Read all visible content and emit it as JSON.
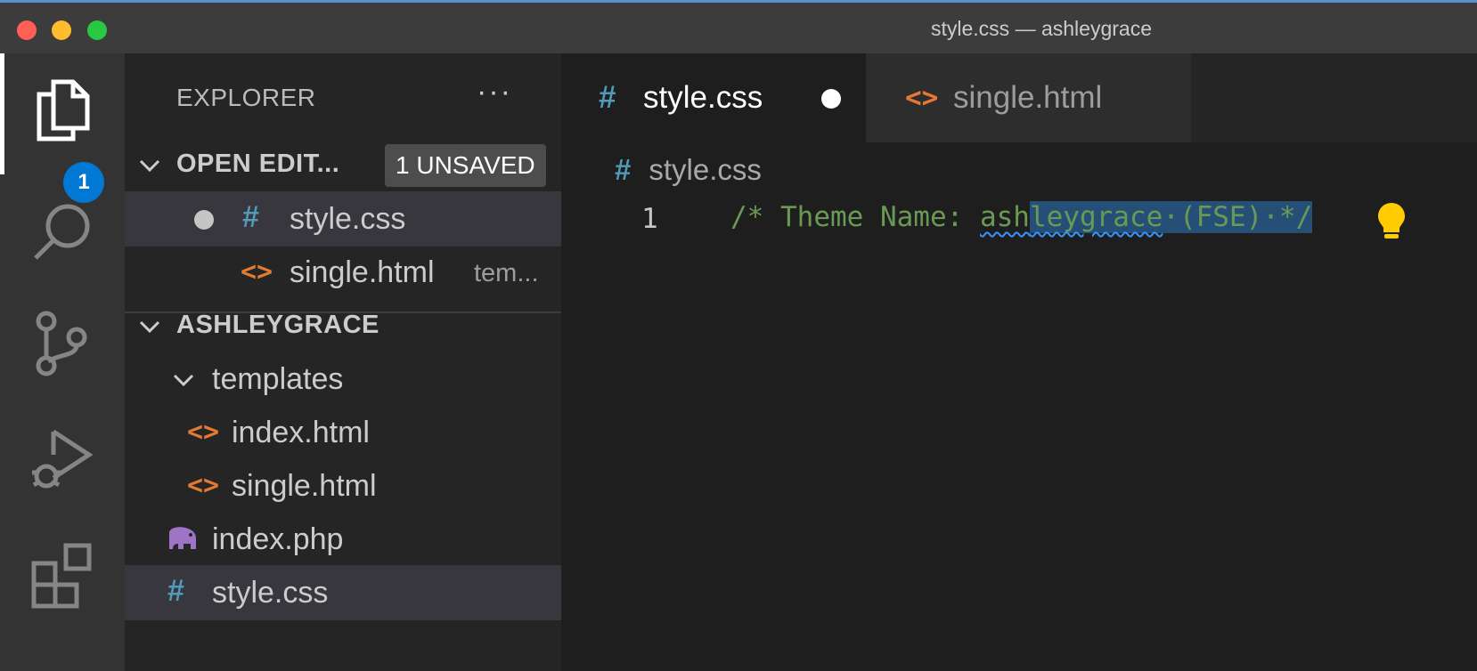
{
  "window": {
    "title": "style.css — ashleygrace"
  },
  "activity_bar": {
    "explorer_badge": "1"
  },
  "sidebar": {
    "header_title": "EXPLORER",
    "more_actions": "···",
    "open_editors": {
      "label": "OPEN EDIT...",
      "unsaved_badge": "1 UNSAVED",
      "items": [
        {
          "name": "style.css",
          "icon": "#",
          "description": "",
          "unsaved": true
        },
        {
          "name": "single.html",
          "icon": "<>",
          "description": "tem..."
        }
      ]
    },
    "workspace": {
      "label": "ASHLEYGRACE",
      "folder": "templates",
      "folder_items": [
        {
          "name": "index.html",
          "icon": "<>"
        },
        {
          "name": "single.html",
          "icon": "<>"
        }
      ],
      "root_items": [
        {
          "name": "index.php",
          "icon": "php-elephant-icon"
        },
        {
          "name": "style.css",
          "icon": "#"
        }
      ]
    }
  },
  "tabs": [
    {
      "label": "style.css",
      "icon": "#",
      "active": true,
      "dirty": true
    },
    {
      "label": "single.html",
      "icon": "<>",
      "active": false,
      "dirty": false
    }
  ],
  "editor": {
    "breadcrumb_icon": "#",
    "breadcrumb_file": "style.css",
    "line_number": "1",
    "code_prefix": "/* Theme Name: ",
    "code_squiggle_plain": "ash",
    "code_squiggle_selected": "leygrace",
    "code_selected_rest": "·(FSE)·*/"
  },
  "colors": {
    "css_icon": "#519aba",
    "html_icon": "#e37933",
    "php_icon": "#a074c4",
    "comment": "#6a9955",
    "selection": "#264f78",
    "badge": "#0078d4"
  }
}
